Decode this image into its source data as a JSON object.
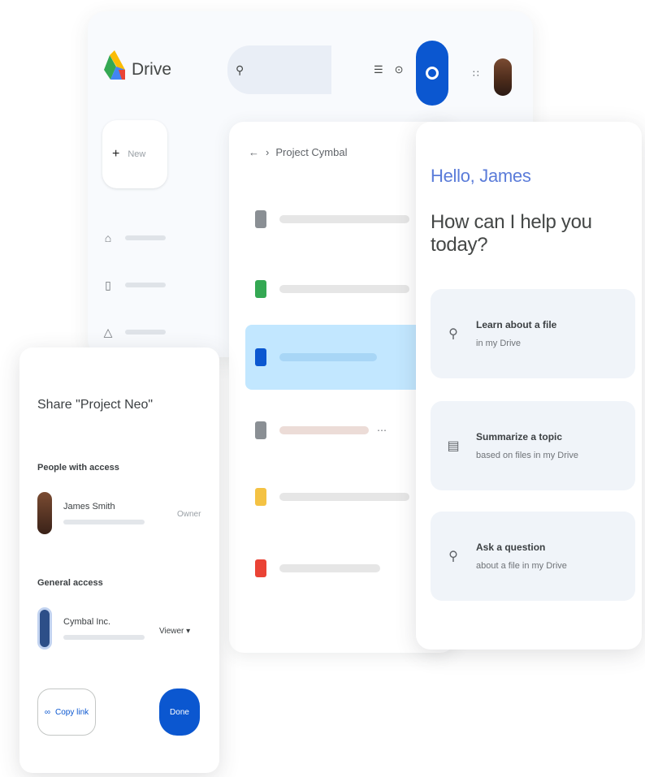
{
  "app": {
    "name": "Drive",
    "colors": {
      "accent": "#0b57d0",
      "selected_row": "#c2e7ff",
      "greeting": "#5b7cd9"
    }
  },
  "topbar": {
    "search_icon": "search-icon",
    "settings_icons": [
      "sliders-icon",
      "help-icon"
    ],
    "apps_icon": "apps-grid-icon"
  },
  "sidebar": {
    "new_label": "New",
    "items": [
      {
        "icon": "home-icon"
      },
      {
        "icon": "drive-icon"
      },
      {
        "icon": "shared-icon"
      }
    ]
  },
  "file_list": {
    "breadcrumb": "Project Cymbal",
    "files": [
      {
        "type": "doc",
        "color": "#8a8f94"
      },
      {
        "type": "sheet",
        "color": "#34a853"
      },
      {
        "type": "doc",
        "color": "#0b57d0",
        "selected": true
      },
      {
        "type": "doc",
        "color": "#8a8f94"
      },
      {
        "type": "slides",
        "color": "#f4c243"
      },
      {
        "type": "pdf",
        "color": "#ea4335"
      }
    ]
  },
  "gemini": {
    "greeting": "Hello, James",
    "question": "How can I help you today?",
    "suggestions": [
      {
        "icon": "lightbulb-icon",
        "title": "Learn about a file",
        "subtitle": "in my Drive"
      },
      {
        "icon": "document-icon",
        "title": "Summarize a topic",
        "subtitle": "based on files in my Drive"
      },
      {
        "icon": "lightbulb-icon",
        "title": "Ask a question",
        "subtitle": "about a file in my Drive"
      }
    ]
  },
  "share": {
    "title": "Share \"Project Neo\"",
    "people_label": "People with access",
    "person": {
      "name": "James Smith",
      "role": "Owner"
    },
    "general_label": "General access",
    "general": {
      "name": "Cymbal Inc.",
      "role": "Viewer"
    },
    "copy_link": "Copy link",
    "done": "Done"
  }
}
